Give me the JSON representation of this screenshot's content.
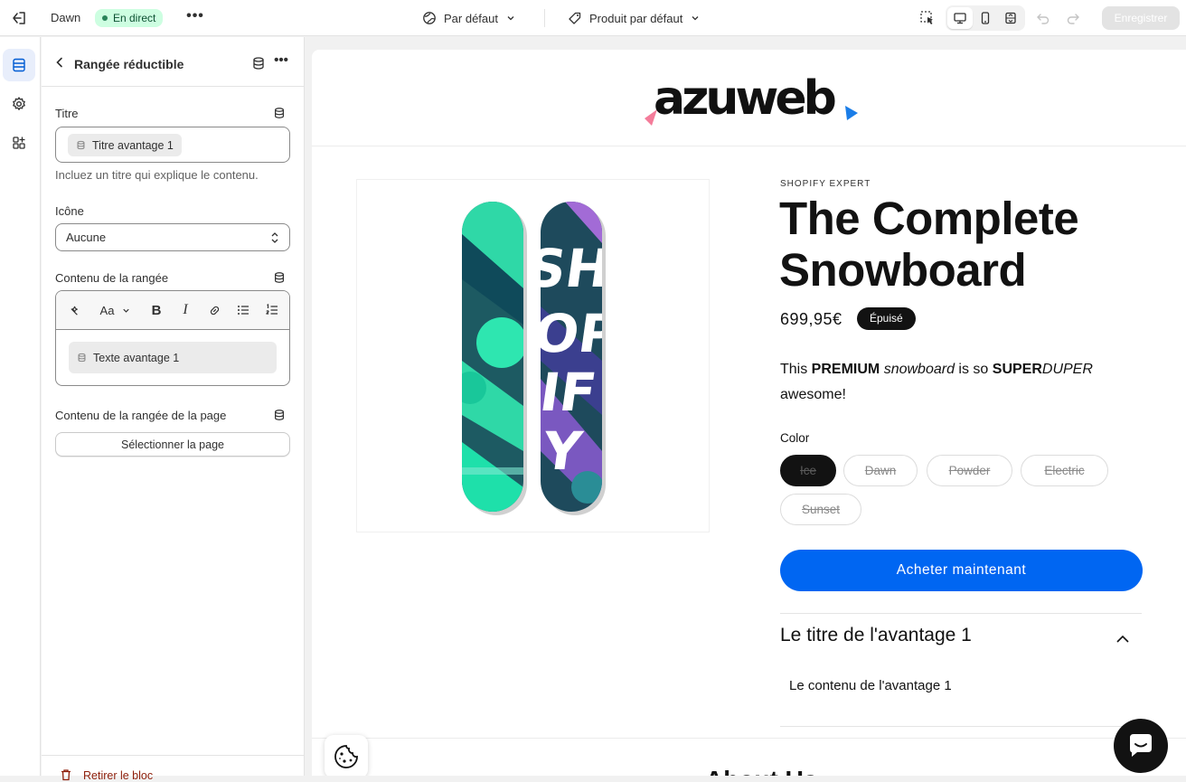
{
  "topbar": {
    "theme_name": "Dawn",
    "status_badge": "En direct",
    "more_label": "•••",
    "context_selector": "Par défaut",
    "template_selector": "Produit par défaut",
    "save_label": "Enregistrer"
  },
  "panel": {
    "title": "Rangée réductible",
    "more_label": "•••",
    "fields": {
      "title_label": "Titre",
      "title_value": "Titre avantage 1",
      "title_help": "Incluez un titre qui explique le contenu.",
      "icon_label": "Icône",
      "icon_value": "Aucune",
      "content_label": "Contenu de la rangée",
      "content_value": "Texte avantage 1",
      "page_content_label": "Contenu de la rangée de la page",
      "page_button": "Sélectionner la page"
    },
    "toolbar": {
      "font_label": "Aa",
      "bold": "B",
      "italic": "I"
    },
    "remove_label": "Retirer le bloc"
  },
  "store": {
    "logo_text": "azuweb",
    "vendor": "SHOPIFY EXPERT",
    "product_title": "The Complete Snowboard",
    "price": "699,95€",
    "sold_out": "Épuisé",
    "description": {
      "p1": "This ",
      "b1": "PREMIUM",
      "p2": " ",
      "i1": "snowboard",
      "p3": " is so ",
      "b2": "SUPER",
      "i2": "DUPER",
      "p4": " awesome!"
    },
    "color_label": "Color",
    "colors": [
      "Ice",
      "Dawn",
      "Powder",
      "Electric",
      "Sunset"
    ],
    "buy_label": "Acheter maintenant",
    "accordion_title": "Le titre de l'avantage 1",
    "accordion_content": "Le contenu de l'avantage 1",
    "next_section_heading": "About Us"
  },
  "colors": {
    "accent_blue": "#0066f2",
    "live_badge_bg": "#cdfee1",
    "board_teal": "#2ee6b0",
    "board_purple": "#a26bd6"
  },
  "icons": [
    "exit-icon",
    "globe-icon",
    "tag-icon",
    "inspector-icon",
    "desktop-icon",
    "mobile-icon",
    "fullwidth-icon",
    "undo-icon",
    "redo-icon",
    "sections-icon",
    "settings-icon",
    "apps-icon",
    "database-icon",
    "cookie-icon",
    "chat-icon"
  ]
}
